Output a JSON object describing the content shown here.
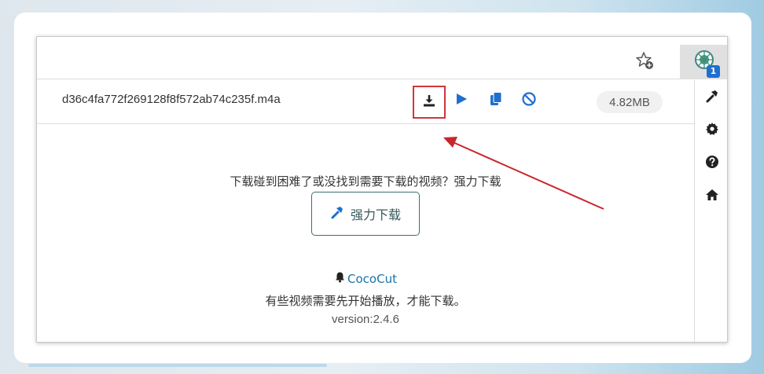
{
  "download_item": {
    "file_name": "d36c4fa772f269128f8f572ab74c235f.m4a",
    "size": "4.82MB"
  },
  "popup": {
    "hint_text": "下载碰到困难了或没找到需要下载的视频？强力下载",
    "force_download_label": "强力下载",
    "brand_name": "CocoCut",
    "note": "有些视频需要先开始播放，才能下载。",
    "version": "version:2.4.6"
  },
  "extension": {
    "badge_count": "1"
  },
  "colors": {
    "accent_blue": "#1f6fd1",
    "highlight_red": "#d1363b",
    "button_border": "#3a6e73",
    "link_blue": "#1a73a8"
  },
  "icons": {
    "download": "download-icon",
    "play": "play-icon",
    "copy": "copy-icon",
    "block": "block-icon",
    "star": "star-add-icon",
    "extension": "cococut-extension-icon",
    "hammer": "hammer-icon",
    "settings": "gear-icon",
    "help": "question-icon",
    "home": "home-icon",
    "bell": "bell-icon"
  }
}
